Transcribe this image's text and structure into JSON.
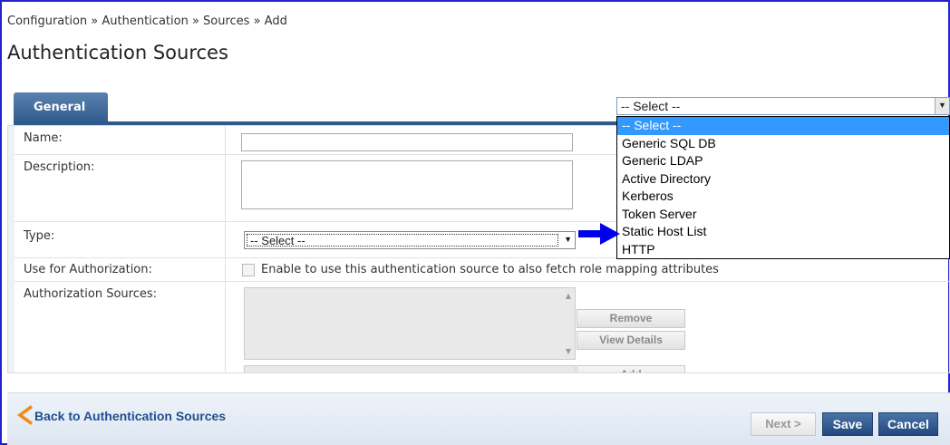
{
  "breadcrumb": "Configuration » Authentication » Sources » Add",
  "page_title": "Authentication Sources",
  "tabs": [
    {
      "label": "General"
    }
  ],
  "form": {
    "name_label": "Name:",
    "name_value": "",
    "description_label": "Description:",
    "description_value": "",
    "type_label": "Type:",
    "type_value": "-- Select --",
    "use_for_authorization_label": "Use for Authorization:",
    "use_for_authorization_text": "Enable to use this authentication source to also fetch role mapping attributes",
    "use_for_authorization_checked": false,
    "authorization_sources_label": "Authorization Sources:",
    "remove_label": "Remove",
    "view_details_label": "View Details",
    "add_label": "Add"
  },
  "type_dropdown": {
    "selected": "-- Select --",
    "options": [
      "-- Select --",
      "Generic SQL DB",
      "Generic LDAP",
      "Active Directory",
      "Kerberos",
      "Token Server",
      "Static Host List",
      "HTTP"
    ]
  },
  "footer": {
    "back_label": "Back to Authentication Sources",
    "next_label": "Next >",
    "save_label": "Save",
    "cancel_label": "Cancel"
  },
  "colors": {
    "accent": "#2f5a8c",
    "highlight": "#3399ff",
    "annotation_arrow": "#0000ee",
    "back_arrow": "#f08a1c"
  },
  "icons": [
    "chevron-down-icon",
    "back-arrow-icon",
    "annotation-arrow-icon",
    "scroll-up-icon",
    "scroll-down-icon"
  ]
}
